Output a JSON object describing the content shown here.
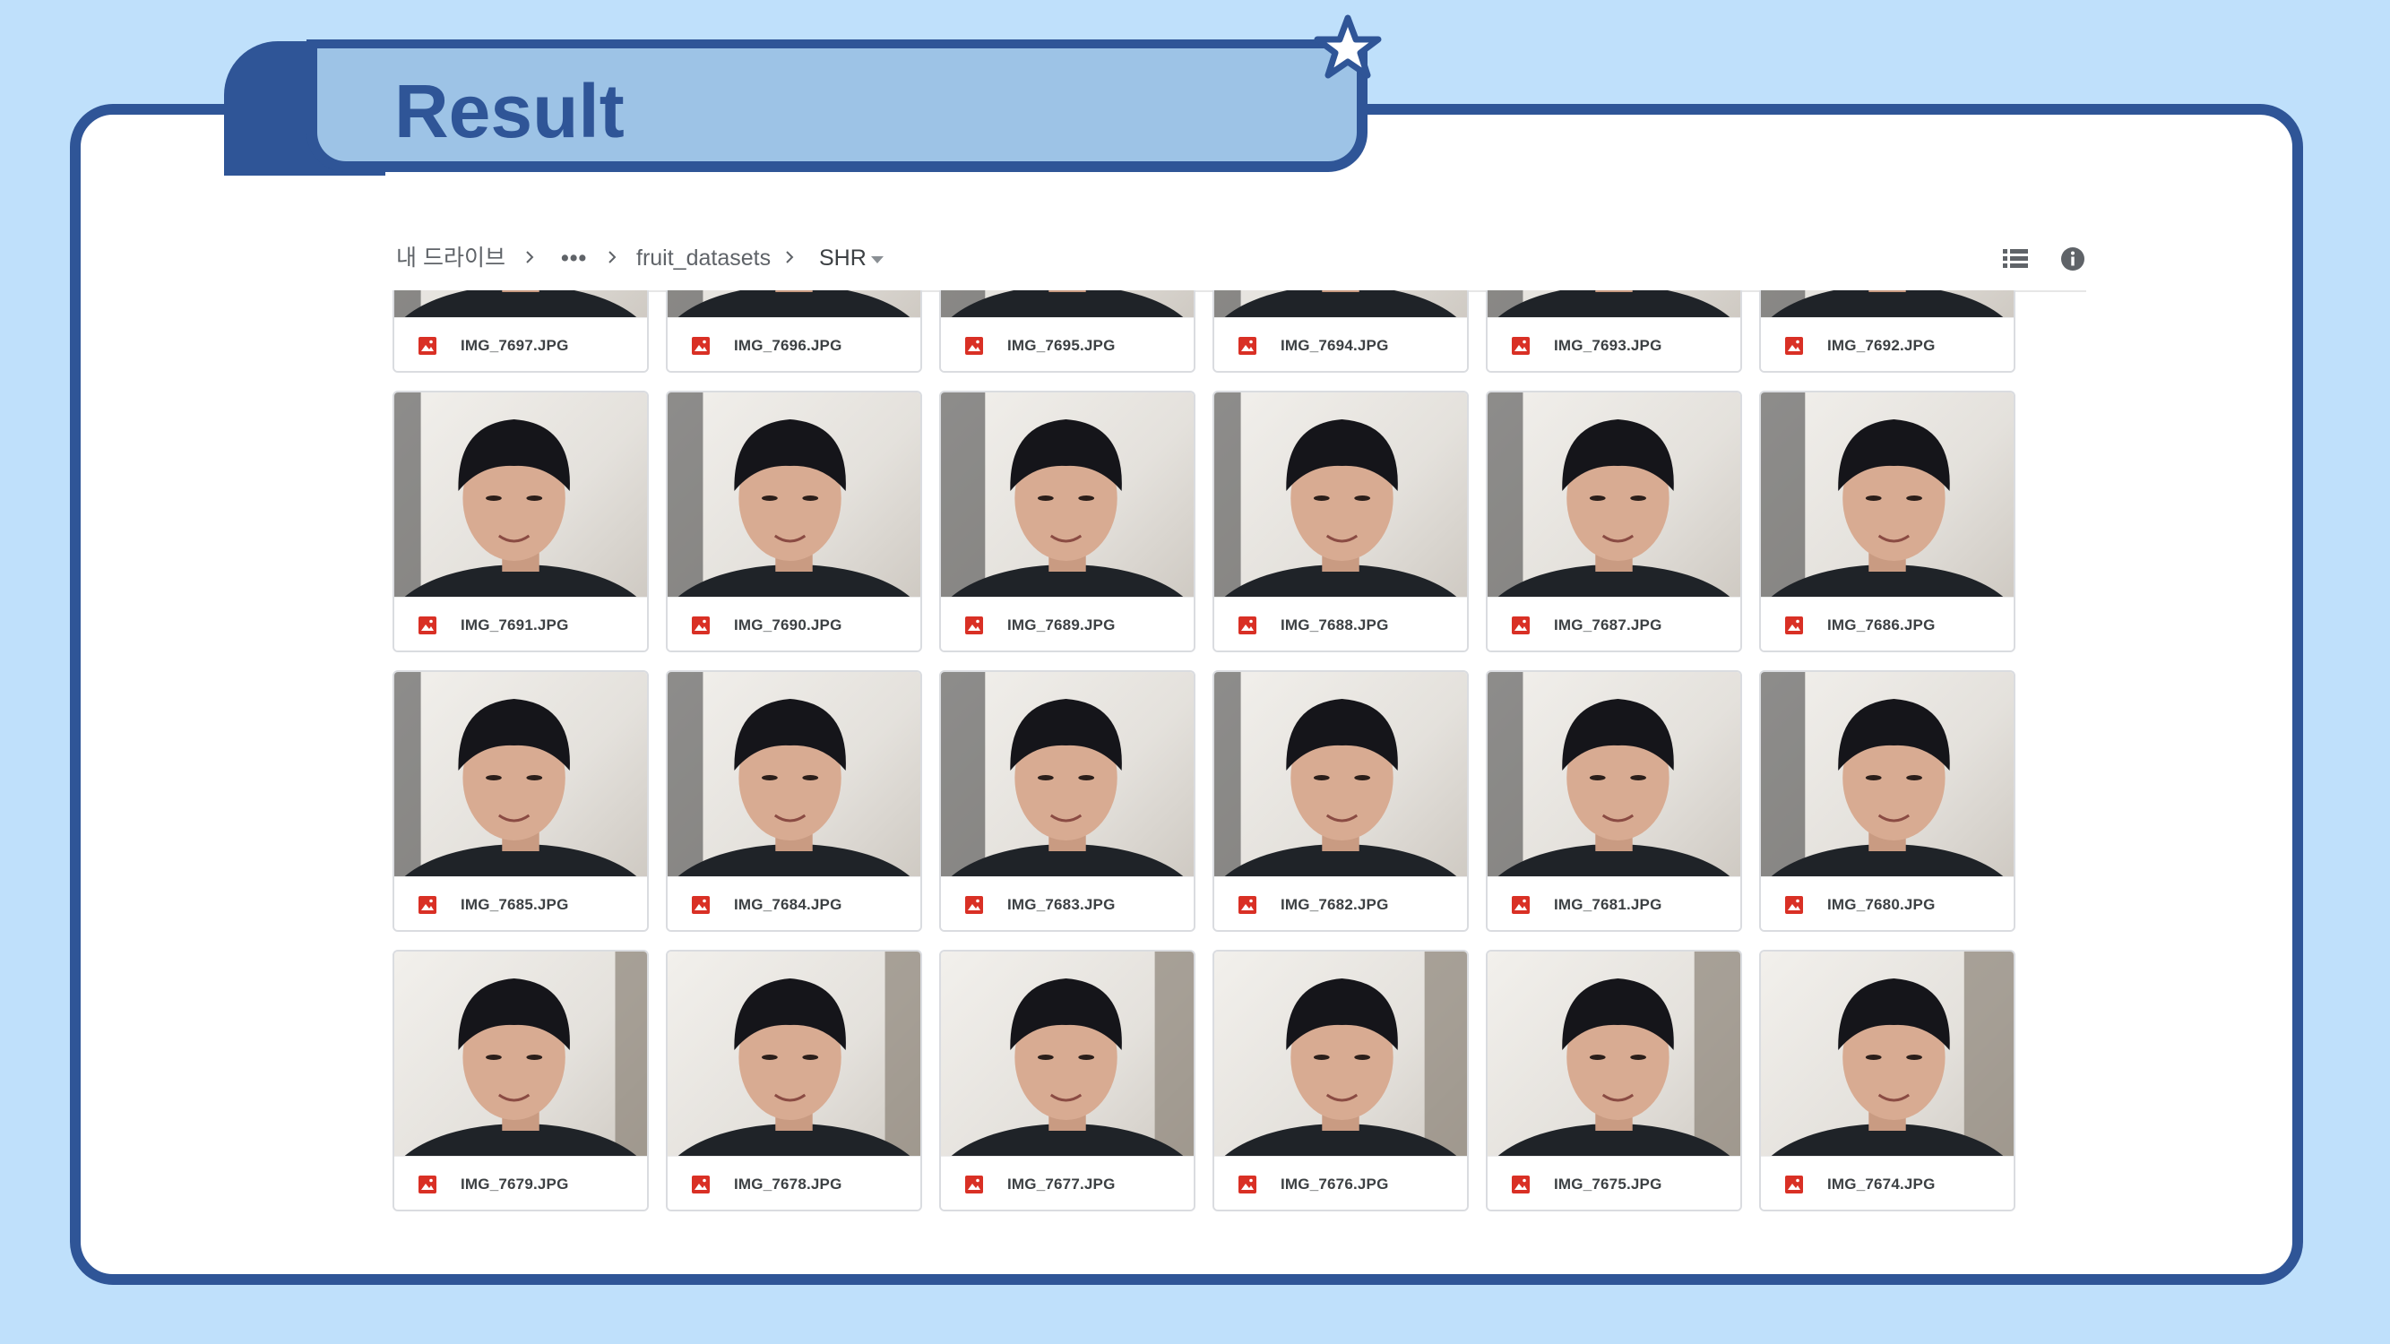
{
  "slide": {
    "title": "Result"
  },
  "breadcrumb": {
    "root": "내 드라이브",
    "ellipsis": "•••",
    "folder": "fruit_datasets",
    "current": "SHR"
  },
  "toolbar": {
    "list_view_icon": "list-view-icon",
    "info_icon": "info-icon"
  },
  "file_icon": "image-file-icon",
  "colors": {
    "background": "#bfe0fb",
    "frame": "#2f5597",
    "tab_fill": "#9dc3e6",
    "file_icon_red": "#d93025"
  },
  "files": [
    "IMG_7697.JPG",
    "IMG_7696.JPG",
    "IMG_7695.JPG",
    "IMG_7694.JPG",
    "IMG_7693.JPG",
    "IMG_7692.JPG",
    "IMG_7691.JPG",
    "IMG_7690.JPG",
    "IMG_7689.JPG",
    "IMG_7688.JPG",
    "IMG_7687.JPG",
    "IMG_7686.JPG",
    "IMG_7685.JPG",
    "IMG_7684.JPG",
    "IMG_7683.JPG",
    "IMG_7682.JPG",
    "IMG_7681.JPG",
    "IMG_7680.JPG",
    "IMG_7679.JPG",
    "IMG_7678.JPG",
    "IMG_7677.JPG",
    "IMG_7676.JPG",
    "IMG_7675.JPG",
    "IMG_7674.JPG"
  ]
}
